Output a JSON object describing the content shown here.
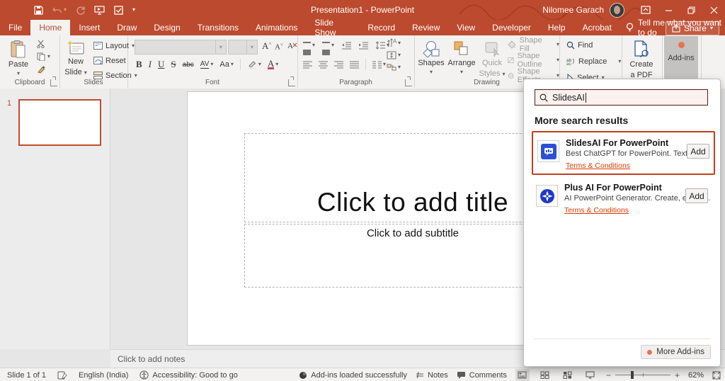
{
  "colors": {
    "accent": "#BC4A2E",
    "link": "#D83B01",
    "card_highlight_border": "#C43E1C",
    "search_bg": "#FBF1EE",
    "logo_blue": "#2B50D6"
  },
  "titlebar": {
    "title": "Presentation1 - PowerPoint",
    "user_name": "Nilomee Garach",
    "qat_icons": [
      "save-icon",
      "undo-icon",
      "redo-icon",
      "start-slideshow-icon",
      "touch-mode-icon",
      "customize-qat-icon"
    ],
    "window_icons": [
      "ribbon-display-options-icon",
      "minimize-icon",
      "restore-icon",
      "close-icon"
    ]
  },
  "tabs": {
    "items": [
      {
        "label": "File",
        "selected": false
      },
      {
        "label": "Home",
        "selected": true
      },
      {
        "label": "Insert",
        "selected": false
      },
      {
        "label": "Draw",
        "selected": false
      },
      {
        "label": "Design",
        "selected": false
      },
      {
        "label": "Transitions",
        "selected": false
      },
      {
        "label": "Animations",
        "selected": false
      },
      {
        "label": "Slide Show",
        "selected": false
      },
      {
        "label": "Record",
        "selected": false
      },
      {
        "label": "Review",
        "selected": false
      },
      {
        "label": "View",
        "selected": false
      },
      {
        "label": "Developer",
        "selected": false
      },
      {
        "label": "Help",
        "selected": false
      },
      {
        "label": "Acrobat",
        "selected": false
      }
    ],
    "tell_me": "Tell me what you want to do",
    "share": "Share"
  },
  "ribbon": {
    "clipboard": {
      "paste": "Paste",
      "label": "Clipboard"
    },
    "slides": {
      "new1": "New",
      "new2": "Slide",
      "layout": "Layout",
      "reset": "Reset",
      "section": "Section",
      "label": "Slides"
    },
    "font": {
      "bold": "B",
      "italic": "I",
      "underline": "U",
      "strike": "S",
      "strikethrough": "abc",
      "spacing": "AV",
      "case": "Aa",
      "grow": "A",
      "shrink": "A",
      "color": "A",
      "label": "Font"
    },
    "paragraph": {
      "label": "Paragraph"
    },
    "drawing": {
      "shapes": "Shapes",
      "arrange": "Arrange",
      "quick1": "Quick",
      "quick2": "Styles",
      "fill": "Shape Fill",
      "outline": "Shape Outline",
      "effects": "Shape Effects",
      "label": "Drawing"
    },
    "editing": {
      "find": "Find",
      "replace": "Replace",
      "select": "Select"
    },
    "acrobat": {
      "line1": "Create",
      "line2": "a PDF"
    },
    "addins": {
      "label": "Add-ins"
    }
  },
  "addins_panel": {
    "search_value": "SlidesAI",
    "results_heading": "More search results",
    "results": [
      {
        "name": "SlidesAI For PowerPoint",
        "description": "Best ChatGPT for PowerPoint. Text to P...",
        "terms": "Terms & Conditions",
        "add": "Add"
      },
      {
        "name": "Plus AI For PowerPoint",
        "description": "AI PowerPoint Generator. Create, edit, a...",
        "terms": "Terms & Conditions",
        "add": "Add"
      }
    ],
    "more_addins": "More Add-ins"
  },
  "slide": {
    "thumbnail_number": "1",
    "title_placeholder": "Click to add title",
    "subtitle_placeholder": "Click to add subtitle"
  },
  "notes": {
    "placeholder": "Click to add notes"
  },
  "statusbar": {
    "slide_indicator": "Slide 1 of 1",
    "language": "English (India)",
    "accessibility": "Accessibility: Good to go",
    "addins_status": "Add-ins loaded successfully",
    "notes": "Notes",
    "comments": "Comments",
    "zoom_level": "62%"
  }
}
